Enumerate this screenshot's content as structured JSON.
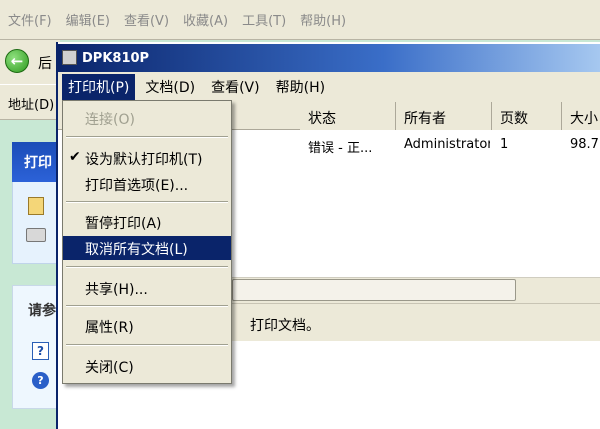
{
  "explorer": {
    "menu": [
      "文件(F)",
      "编辑(E)",
      "查看(V)",
      "收藏(A)",
      "工具(T)",
      "帮助(H)"
    ],
    "back_label": "后",
    "address_label": "地址(D)",
    "task_box1_title": "打印",
    "task_box2_title": "请参",
    "help_icon1_glyph": "?",
    "help_icon2_glyph": "?"
  },
  "queue": {
    "title": "DPK810P",
    "menu": [
      "打印机(P)",
      "文档(D)",
      "查看(V)",
      "帮助(H)"
    ],
    "active_menu_index": 0,
    "columns": [
      "状态",
      "所有者",
      "页数",
      "大小"
    ],
    "rows": [
      {
        "status": "错误 - 正...",
        "owner": "Administrator",
        "pages": "1",
        "size": "98.7"
      }
    ],
    "status_text": "打印文档。"
  },
  "dropdown": {
    "items": [
      {
        "label": "连接(O)",
        "disabled": true,
        "checked": false
      },
      {
        "label": "设为默认打印机(T)",
        "disabled": false,
        "checked": true
      },
      {
        "label": "打印首选项(E)...",
        "disabled": false,
        "checked": false
      },
      {
        "label": "暂停打印(A)",
        "disabled": false,
        "checked": false
      },
      {
        "label": "取消所有文档(L)",
        "disabled": false,
        "checked": false,
        "highlighted": true
      },
      {
        "label": "共享(H)...",
        "disabled": false,
        "checked": false
      },
      {
        "label": "属性(R)",
        "disabled": false,
        "checked": false
      },
      {
        "label": "关闭(C)",
        "disabled": false,
        "checked": false
      }
    ],
    "check_glyph": "✔"
  },
  "colors": {
    "highlight": "#0a246a",
    "title_gradient_start": "#0a246a",
    "menu_bg": "#ece9d8",
    "backdrop": "#c8e8d4"
  }
}
